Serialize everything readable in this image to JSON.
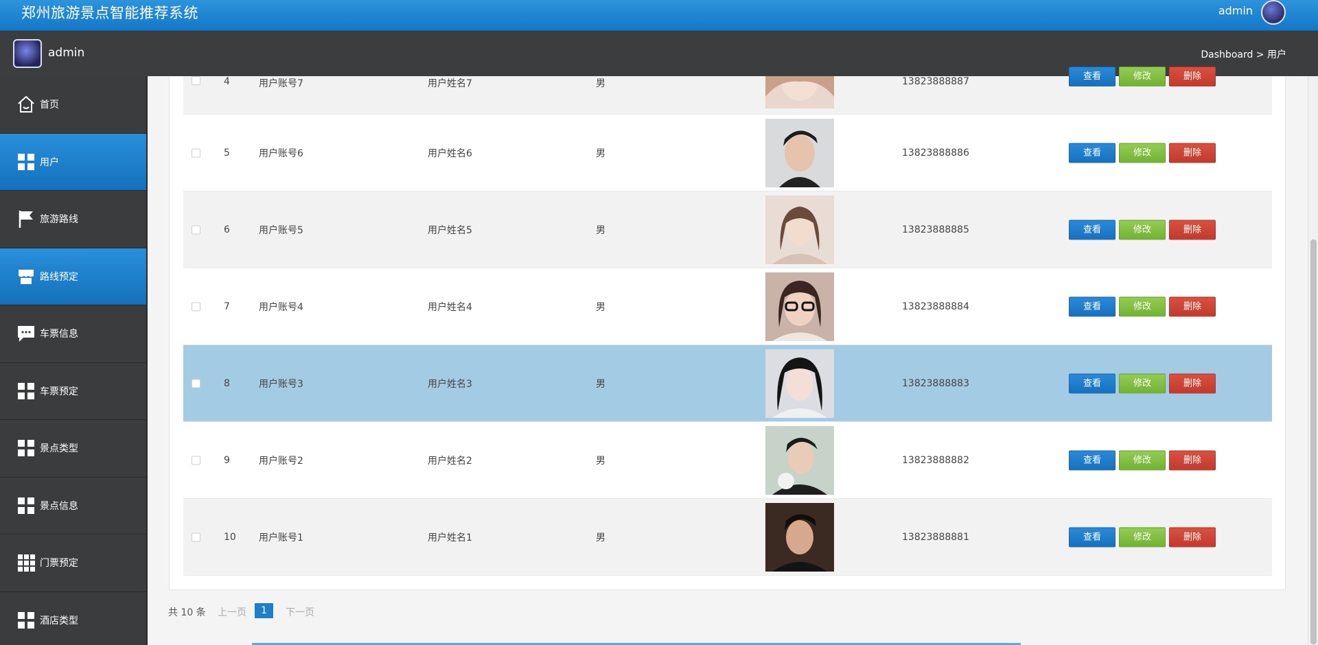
{
  "header": {
    "title": "郑州旅游景点智能推荐系统",
    "user": "admin"
  },
  "subheader": {
    "user": "admin",
    "breadcrumb": "Dashboard > 用户"
  },
  "sidebar": {
    "items": [
      {
        "label": "首页",
        "icon": "home-icon"
      },
      {
        "label": "用户",
        "icon": "grid-icon"
      },
      {
        "label": "旅游路线",
        "icon": "flag-icon"
      },
      {
        "label": "路线预定",
        "icon": "store-icon"
      },
      {
        "label": "车票信息",
        "icon": "chat-icon"
      },
      {
        "label": "车票预定",
        "icon": "grid-icon"
      },
      {
        "label": "景点类型",
        "icon": "grid-icon"
      },
      {
        "label": "景点信息",
        "icon": "grid-icon"
      },
      {
        "label": "门票预定",
        "icon": "grid9-icon"
      },
      {
        "label": "酒店类型",
        "icon": "grid-icon"
      }
    ]
  },
  "actions": {
    "view": "查看",
    "edit": "修改",
    "delete": "删除"
  },
  "table": {
    "rows": [
      {
        "no": "4",
        "account": "用户账号7",
        "name": "用户姓名7",
        "sex": "男",
        "phone": "13823888887"
      },
      {
        "no": "5",
        "account": "用户账号6",
        "name": "用户姓名6",
        "sex": "男",
        "phone": "13823888886"
      },
      {
        "no": "6",
        "account": "用户账号5",
        "name": "用户姓名5",
        "sex": "男",
        "phone": "13823888885"
      },
      {
        "no": "7",
        "account": "用户账号4",
        "name": "用户姓名4",
        "sex": "男",
        "phone": "13823888884"
      },
      {
        "no": "8",
        "account": "用户账号3",
        "name": "用户姓名3",
        "sex": "男",
        "phone": "13823888883"
      },
      {
        "no": "9",
        "account": "用户账号2",
        "name": "用户姓名2",
        "sex": "男",
        "phone": "13823888882"
      },
      {
        "no": "10",
        "account": "用户账号1",
        "name": "用户姓名1",
        "sex": "男",
        "phone": "13823888881"
      }
    ]
  },
  "pagination": {
    "total": "共 10 条",
    "prev": "上一页",
    "page": "1",
    "next": "下一页"
  },
  "colors": {
    "accent": "#1c7fc7",
    "edit": "#7dbb3d",
    "delete": "#cc4433",
    "selected_row": "#a4cbe4"
  }
}
